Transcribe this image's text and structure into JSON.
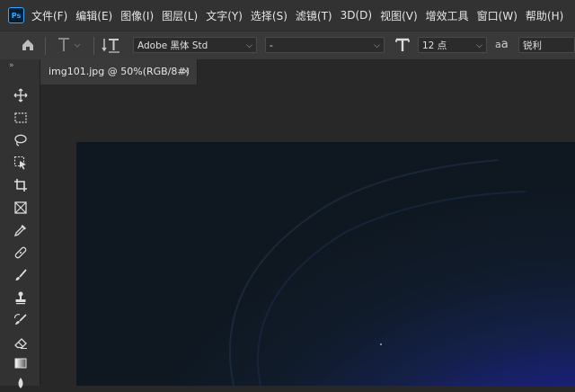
{
  "app": {
    "logo": "Ps"
  },
  "menu": [
    "文件(F)",
    "编辑(E)",
    "图像(I)",
    "图层(L)",
    "文字(Y)",
    "选择(S)",
    "滤镜(T)",
    "3D(D)",
    "视图(V)",
    "增效工具",
    "窗口(W)",
    "帮助(H)"
  ],
  "options": {
    "font_family": "Adobe 黑体 Std",
    "font_style": "-",
    "font_size": "12 点",
    "aa_icon_label": "a",
    "anti_alias": "锐利"
  },
  "toolbar": {
    "collapse": "»"
  },
  "document": {
    "tab_title": "img101.jpg @ 50%(RGB/8#)",
    "close": "×"
  },
  "colors": {
    "menubar": "#323232",
    "optionsbar": "#393939",
    "workspace": "#282828",
    "accent": "#31a8ff"
  }
}
